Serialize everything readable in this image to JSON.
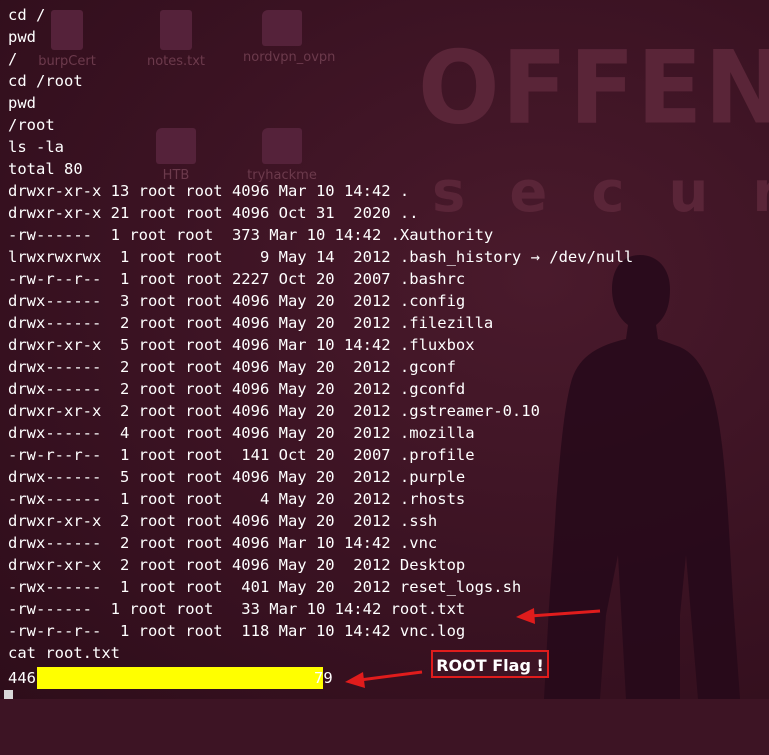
{
  "desktop": {
    "brand_text": "OFFENSIV",
    "brand_sub_text": "securi",
    "icons": [
      {
        "name": "burpCert",
        "kind": "file"
      },
      {
        "name": "notes.txt",
        "kind": "file"
      },
      {
        "name": "nordvpn_ovpn",
        "kind": "folder"
      },
      {
        "name": "HTB",
        "kind": "folder"
      },
      {
        "name": "tryhackme",
        "kind": "folder"
      }
    ]
  },
  "terminal": {
    "lines": [
      "cd /",
      "pwd",
      "/",
      "cd /root",
      "pwd",
      "/root",
      "ls -la",
      "total 80",
      "drwxr-xr-x 13 root root 4096 Mar 10 14:42 .",
      "drwxr-xr-x 21 root root 4096 Oct 31  2020 ..",
      "-rw------  1 root root  373 Mar 10 14:42 .Xauthority",
      "lrwxrwxrwx  1 root root    9 May 14  2012 .bash_history → /dev/null",
      "-rw-r--r--  1 root root 2227 Oct 20  2007 .bashrc",
      "drwx------  3 root root 4096 May 20  2012 .config",
      "drwx------  2 root root 4096 May 20  2012 .filezilla",
      "drwxr-xr-x  5 root root 4096 Mar 10 14:42 .fluxbox",
      "drwx------  2 root root 4096 May 20  2012 .gconf",
      "drwx------  2 root root 4096 May 20  2012 .gconfd",
      "drwxr-xr-x  2 root root 4096 May 20  2012 .gstreamer-0.10",
      "drwx------  4 root root 4096 May 20  2012 .mozilla",
      "-rw-r--r--  1 root root  141 Oct 20  2007 .profile",
      "drwx------  5 root root 4096 May 20  2012 .purple",
      "-rwx------  1 root root    4 May 20  2012 .rhosts",
      "drwxr-xr-x  2 root root 4096 May 20  2012 .ssh",
      "drwx------  2 root root 4096 Mar 10 14:42 .vnc",
      "drwxr-xr-x  2 root root 4096 May 20  2012 Desktop",
      "-rwx------  1 root root  401 May 20  2012 reset_logs.sh",
      "-rw------  1 root root   33 Mar 10 14:42 root.txt",
      "-rw-r--r--  1 root root  118 Mar 10 14:42 vnc.log",
      "cat root.txt"
    ],
    "flag_prefix": "446",
    "flag_suffix": "79"
  },
  "annotation": {
    "label": "ROOT Flag !",
    "color": "#e01c1c",
    "redaction_color": "#ffff00"
  }
}
